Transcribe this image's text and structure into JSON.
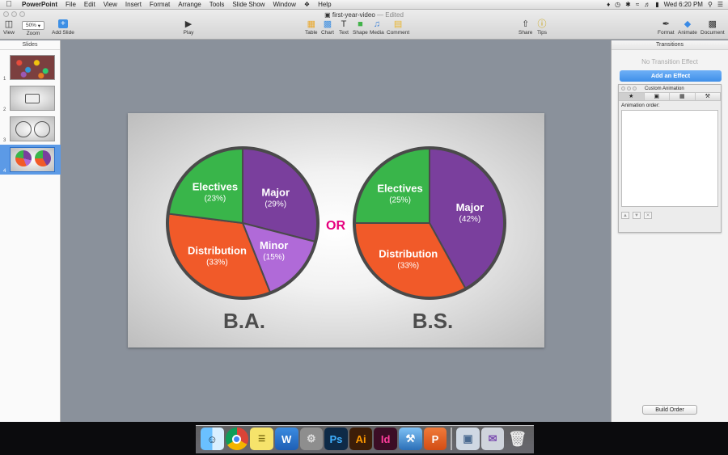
{
  "menubar": {
    "app": "PowerPoint",
    "items": [
      "File",
      "Edit",
      "View",
      "Insert",
      "Format",
      "Arrange",
      "Tools",
      "Slide Show",
      "Window",
      "Help"
    ],
    "clock": "Wed 6:20 PM"
  },
  "window": {
    "title": "first-year-video",
    "status": "Edited"
  },
  "toolbar": {
    "view": "View",
    "zoom_label": "Zoom",
    "zoom_value": "50%",
    "add_slide": "Add Slide",
    "play": "Play",
    "table": "Table",
    "chart": "Chart",
    "text": "Text",
    "shape": "Shape",
    "media": "Media",
    "comment": "Comment",
    "share": "Share",
    "tips": "Tips",
    "format": "Format",
    "animate": "Animate",
    "document": "Document"
  },
  "slides_panel": {
    "header": "Slides",
    "numbers": [
      "1",
      "2",
      "3",
      "4"
    ],
    "selected": 4
  },
  "slide": {
    "or_text": "OR",
    "left_title": "B.A.",
    "right_title": "B.S.",
    "colors": {
      "electives": "#39b54a",
      "major": "#7a3f9d",
      "distribution": "#f15a29",
      "minor": "#b06ad8",
      "or": "#e6007e",
      "title": "#4d4d4d",
      "ring": "#4a4a4a"
    }
  },
  "chart_data": [
    {
      "type": "pie",
      "title": "B.A.",
      "slices": [
        {
          "label": "Major",
          "value_text": "(29%)",
          "value": 29
        },
        {
          "label": "Minor",
          "value_text": "(15%)",
          "value": 15
        },
        {
          "label": "Distribution",
          "value_text": "(33%)",
          "value": 33
        },
        {
          "label": "Electives",
          "value_text": "(23%)",
          "value": 23
        }
      ]
    },
    {
      "type": "pie",
      "title": "B.S.",
      "slices": [
        {
          "label": "Major",
          "value_text": "(42%)",
          "value": 42
        },
        {
          "label": "Distribution",
          "value_text": "(33%)",
          "value": 33
        },
        {
          "label": "Electives",
          "value_text": "(25%)",
          "value": 25
        }
      ]
    }
  ],
  "right_panel": {
    "header": "Transitions",
    "no_effect": "No Transition Effect",
    "add_effect": "Add an Effect",
    "custom_animation": "Custom Animation",
    "animation_order": "Animation order:",
    "build_order": "Build Order"
  },
  "dock": {
    "apps": [
      "finder",
      "chrome",
      "stickies",
      "word",
      "system-preferences",
      "photoshop",
      "illustrator",
      "indesign",
      "xcode",
      "powerpoint",
      "preview",
      "mail",
      "trash"
    ]
  }
}
